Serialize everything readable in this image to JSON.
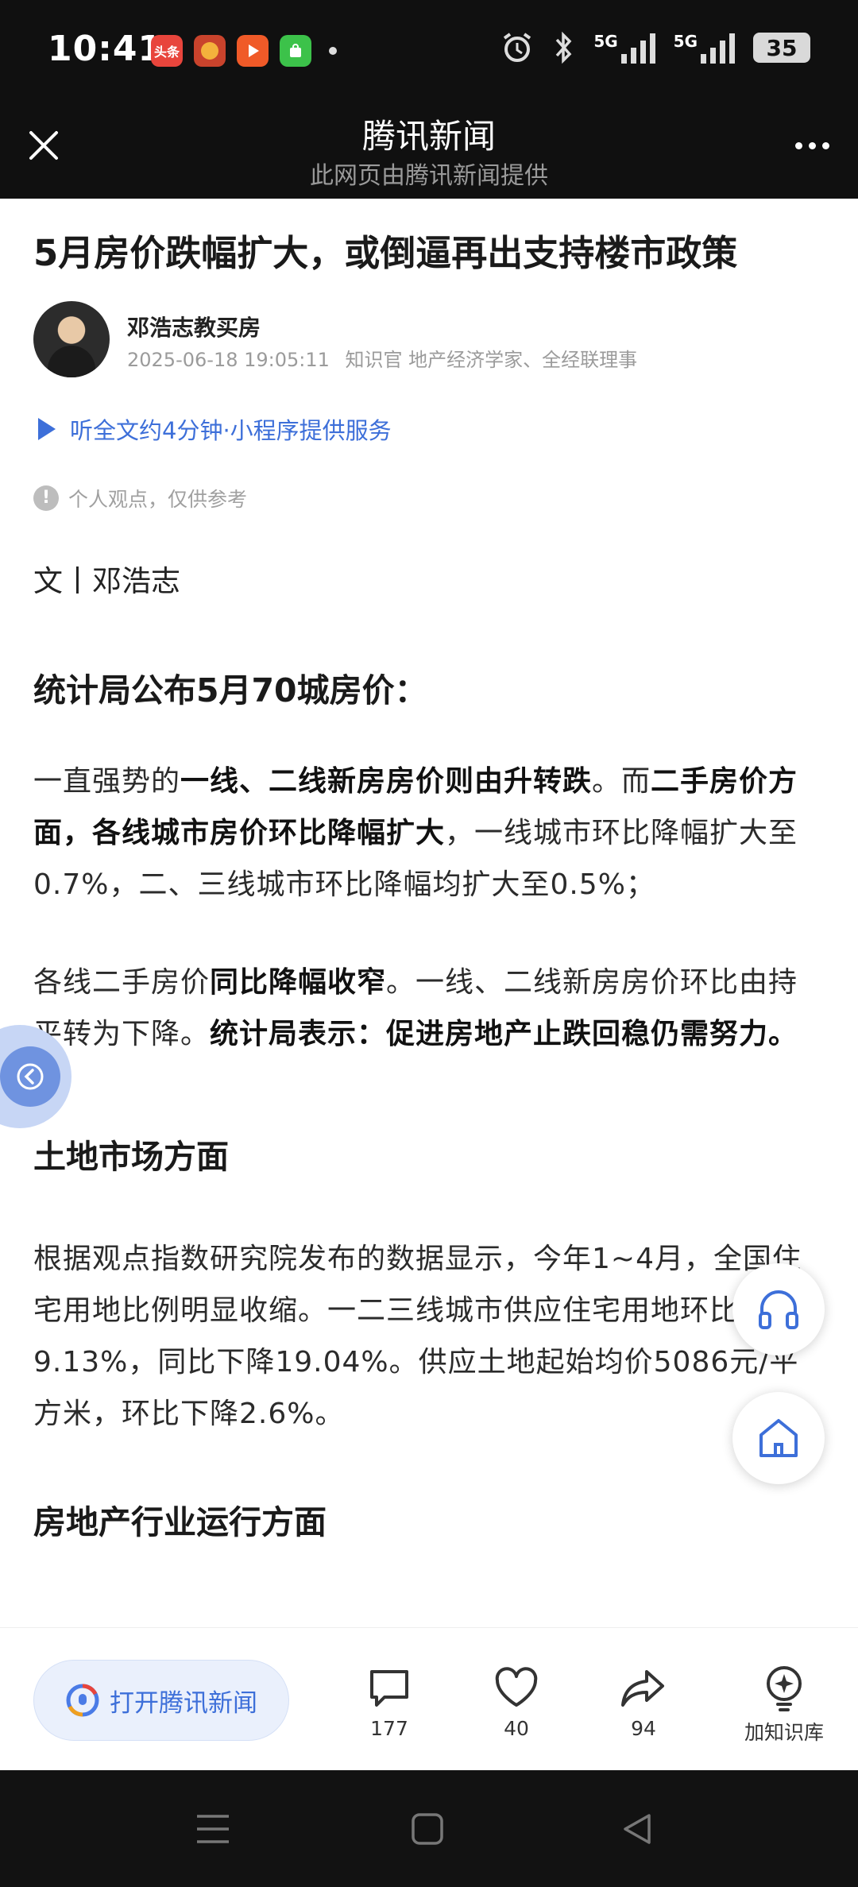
{
  "status_bar": {
    "time": "10:41",
    "apps": [
      {
        "name": "toutiao-app-icon",
        "label": "头条",
        "color": "#e8453c"
      },
      {
        "name": "promo-app-icon",
        "label": "",
        "color": "#c9432c"
      },
      {
        "name": "video-app-icon",
        "label": "",
        "color": "#f05a28"
      },
      {
        "name": "shopping-app-icon",
        "label": "",
        "color": "#3cc24a"
      }
    ],
    "signal_1": "5G",
    "signal_2": "5G",
    "battery": "35"
  },
  "title_bar": {
    "title": "腾讯新闻",
    "subtitle": "此网页由腾讯新闻提供"
  },
  "article": {
    "headline": "5月房价跌幅扩大，或倒逼再出支持楼市政策",
    "author": {
      "name": "邓浩志教买房",
      "datetime": "2025-06-18 19:05:11",
      "meta": "知识官 地产经济学家、全经联理事"
    },
    "listen": "听全文约4分钟·小程序提供服务",
    "notice": "个人观点，仅供参考",
    "byline": "文丨邓浩志",
    "section1_title": "统计局公布5月70城房价：",
    "p1": {
      "s1": "一直强势的",
      "b1": "一线、二线新房房价则由升转跌",
      "s2": "。而",
      "b2": "二手房价方面，各线城市房价环比降幅扩大",
      "s3": "，一线城市环比降幅扩大至0.7%，二、三线城市环比降幅均扩大至0.5%；"
    },
    "p2": {
      "s1": "各线二手房价",
      "b1": "同比降幅收窄",
      "s2": "。一线、二线新房房价环比由持平转为下降。",
      "b2": "统计局表示：促进房地产止跌回稳仍需努力。"
    },
    "section2_title": "土地市场方面",
    "p3": "根据观点指数研究院发布的数据显示，今年1~4月，全国住宅用地比例明显收缩。一二三线城市供应住宅用地环比下降9.13%，同比下降19.04%。供应土地起始均价5086元/平方米，环比下降2.6%。",
    "section3_title": "房地产行业运行方面"
  },
  "bottom_bar": {
    "open_app": "打开腾讯新闻",
    "comments": "177",
    "likes": "40",
    "shares": "94",
    "knowledge": "加知识库"
  },
  "colors": {
    "accent": "#3d6fd9",
    "dark_bar": "#101010"
  }
}
